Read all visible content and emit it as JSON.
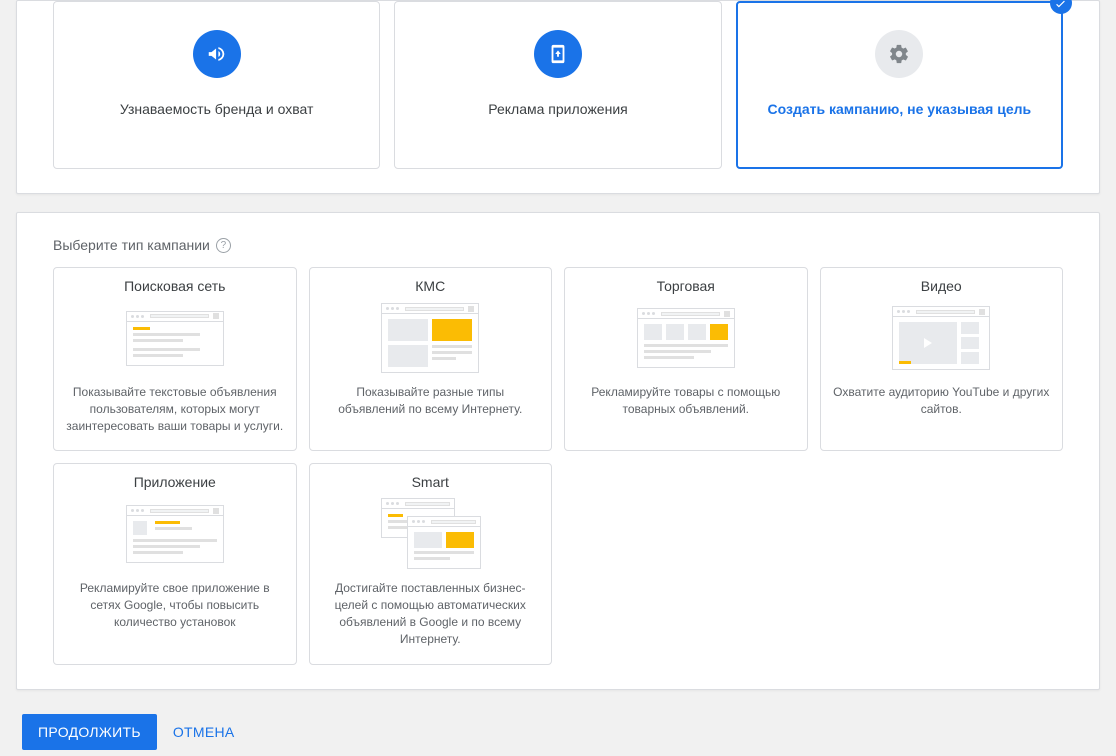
{
  "goals": [
    {
      "title": "Узнаваемость бренда и охват",
      "icon": "megaphone",
      "selected": false
    },
    {
      "title": "Реклама приложения",
      "icon": "phone-download",
      "selected": false
    },
    {
      "title": "Создать кампанию, не указывая цель",
      "icon": "gear",
      "selected": true
    }
  ],
  "campaignType": {
    "label": "Выберите тип кампании",
    "items": [
      {
        "title": "Поисковая сеть",
        "desc": "Показывайте текстовые объявления пользователям, которых могут заинтересовать ваши товары и услуги.",
        "thumb": "search"
      },
      {
        "title": "КМС",
        "desc": "Показывайте разные типы объявлений по всему Интернету.",
        "thumb": "display"
      },
      {
        "title": "Торговая",
        "desc": "Рекламируйте товары с помощью товарных объявлений.",
        "thumb": "shopping"
      },
      {
        "title": "Видео",
        "desc": "Охватите аудиторию YouTube и других сайтов.",
        "thumb": "video"
      },
      {
        "title": "Приложение",
        "desc": "Рекламируйте свое приложение в сетях Google, чтобы повысить количество установок",
        "thumb": "app"
      },
      {
        "title": "Smart",
        "desc": "Достигайте поставленных бизнес-целей с помощью автоматических объявлений в Google и по всему Интернету.",
        "thumb": "smart"
      }
    ]
  },
  "footer": {
    "continue": "ПРОДОЛЖИТЬ",
    "cancel": "ОТМЕНА"
  }
}
